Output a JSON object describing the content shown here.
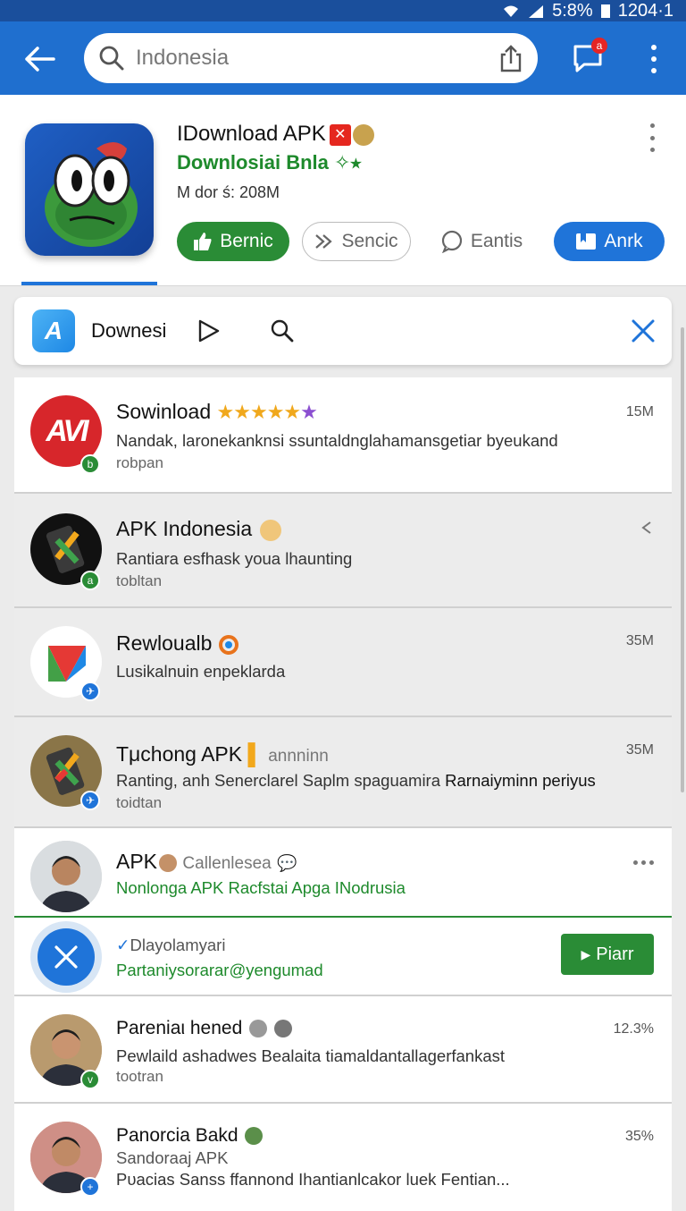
{
  "status_bar": {
    "battery": "5:8%",
    "time": "1204·1"
  },
  "search": {
    "value": "Indonesia"
  },
  "chat_badge": "a",
  "app": {
    "title": "IDownload APK",
    "tag": "✕",
    "subtitle": "Downlosiai Bnla",
    "subtitle_mark": "✧⭑",
    "meta": "M dor ś: 208M",
    "buttons": {
      "primary": "Bernic",
      "secondary": "Sencic",
      "tertiary": "Eantis",
      "action": "Anrk"
    }
  },
  "filter": {
    "logo": "A",
    "label": "Downesi"
  },
  "rows": [
    {
      "title": "Sowinload",
      "desc": "Nandak, laronekanknsi ssuntaldnglahamansgetiar byeukand",
      "sub": "robpan",
      "size": "15M",
      "avatar_text": "AVI",
      "badge": "b"
    },
    {
      "title": "APK Indonesia",
      "desc": "Rantiara esfhask youa lhaunting",
      "sub": "tobltan",
      "badge": "a"
    },
    {
      "title": "Rewloualb",
      "desc": "Lusikalnuin enpeklarda",
      "size": "35M",
      "badge": "✈"
    },
    {
      "title": "Tμchong APK",
      "title_extra": "annninn",
      "desc_a": "Ranting, anh Senerclarel Saplm spaguamira ",
      "desc_b": "Rarnaiyminn periyus",
      "sub": "toidtan",
      "size": "35M",
      "badge": "✈"
    },
    {
      "title": "APK",
      "title_extra": "Callenlesea",
      "desc": "Nonlonga APK Racfstai Apga INodrusia"
    },
    {
      "title": "Dlayolamyari",
      "desc": "Partaniysorarar@yengumad",
      "button": "Piarr"
    },
    {
      "title": "Pareniaι hened",
      "desc": "Pewlaild ashadwes Bealaita tiamaldantallagerfankast",
      "sub": "tootran",
      "size": "12.3%",
      "badge": "v"
    },
    {
      "title": "Panorcia Bakd",
      "desc_green": "Sandoraaj APK",
      "desc": "Pυacias Sanss ffannond Ihantianlcakor luek Fentian...",
      "size": "35%",
      "badge": "+"
    }
  ]
}
